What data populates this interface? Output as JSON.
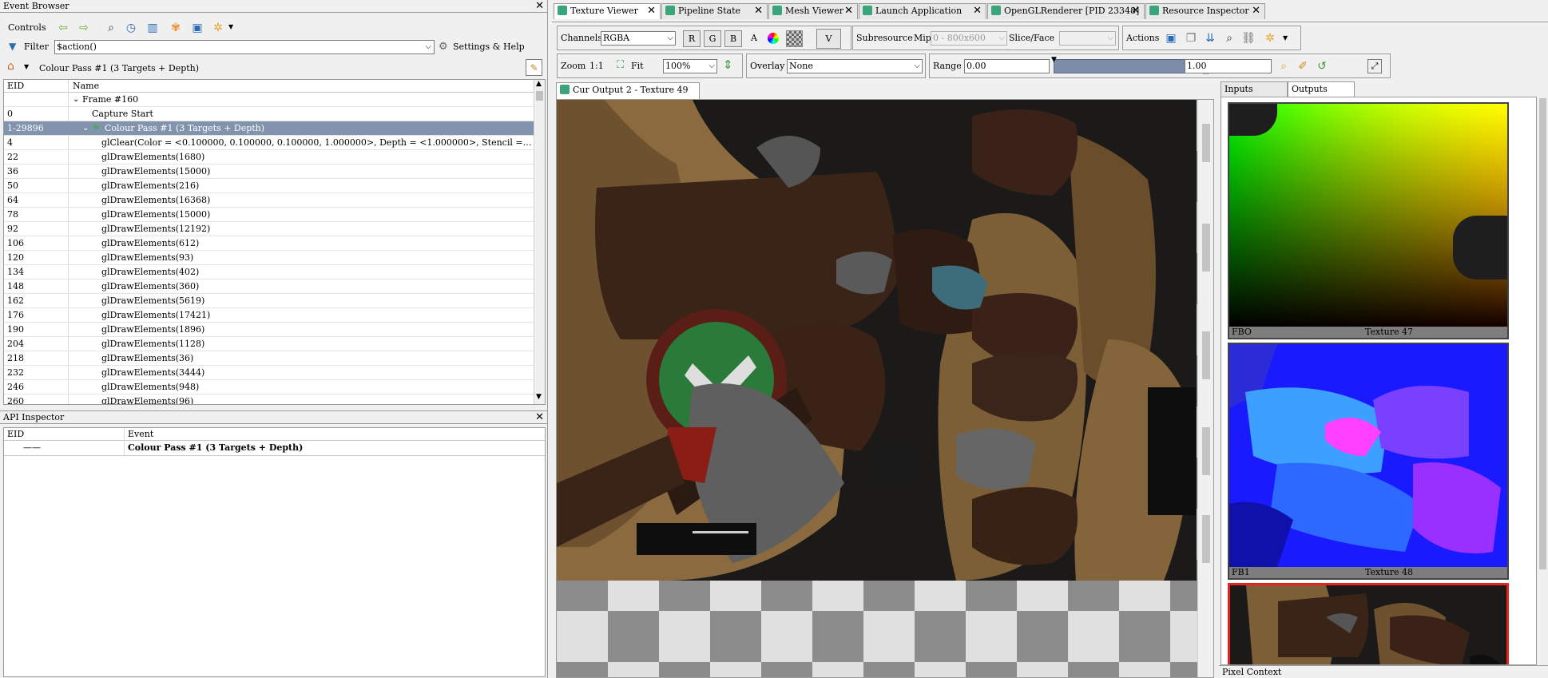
{
  "event_browser": {
    "title": "Event Browser",
    "controls_label": "Controls",
    "filter_label": "Filter",
    "filter_value": "$action()",
    "settings_label": "Settings & Help",
    "breadcrumb": "Colour Pass #1 (3 Targets + Depth)",
    "columns": [
      "EID",
      "Name"
    ],
    "rows": [
      {
        "eid": "",
        "name": "Frame #160",
        "level": 0,
        "expand": true
      },
      {
        "eid": "0",
        "name": "Capture Start",
        "level": 1
      },
      {
        "eid": "1-29896",
        "name": "Colour Pass #1 (3 Targets + Depth)",
        "level": 1,
        "expand": true,
        "flag": true,
        "selected": true
      },
      {
        "eid": "4",
        "name": "glClear(Color = <0.100000, 0.100000, 0.100000, 1.000000>, Depth = <1.000000>, Stencil =…",
        "level": 2
      },
      {
        "eid": "22",
        "name": "glDrawElements(1680)",
        "level": 2
      },
      {
        "eid": "36",
        "name": "glDrawElements(15000)",
        "level": 2
      },
      {
        "eid": "50",
        "name": "glDrawElements(216)",
        "level": 2
      },
      {
        "eid": "64",
        "name": "glDrawElements(16368)",
        "level": 2
      },
      {
        "eid": "78",
        "name": "glDrawElements(15000)",
        "level": 2
      },
      {
        "eid": "92",
        "name": "glDrawElements(12192)",
        "level": 2
      },
      {
        "eid": "106",
        "name": "glDrawElements(612)",
        "level": 2
      },
      {
        "eid": "120",
        "name": "glDrawElements(93)",
        "level": 2
      },
      {
        "eid": "134",
        "name": "glDrawElements(402)",
        "level": 2
      },
      {
        "eid": "148",
        "name": "glDrawElements(360)",
        "level": 2
      },
      {
        "eid": "162",
        "name": "glDrawElements(5619)",
        "level": 2
      },
      {
        "eid": "176",
        "name": "glDrawElements(17421)",
        "level": 2
      },
      {
        "eid": "190",
        "name": "glDrawElements(1896)",
        "level": 2
      },
      {
        "eid": "204",
        "name": "glDrawElements(1128)",
        "level": 2
      },
      {
        "eid": "218",
        "name": "glDrawElements(36)",
        "level": 2
      },
      {
        "eid": "232",
        "name": "glDrawElements(3444)",
        "level": 2
      },
      {
        "eid": "246",
        "name": "glDrawElements(948)",
        "level": 2
      },
      {
        "eid": "260",
        "name": "glDrawElements(96)",
        "level": 2
      }
    ]
  },
  "api_inspector": {
    "title": "API Inspector",
    "columns": [
      "EID",
      "Event"
    ],
    "row": {
      "eid": "——",
      "event": "Colour Pass #1 (3 Targets + Depth)"
    }
  },
  "tabs": [
    {
      "label": "Texture Viewer",
      "active": true
    },
    {
      "label": "Pipeline State"
    },
    {
      "label": "Mesh Viewer"
    },
    {
      "label": "Launch Application"
    },
    {
      "label": "OpenGLRenderer [PID 23348]"
    },
    {
      "label": "Resource Inspector"
    }
  ],
  "toolbar": {
    "channels_label": "Channels",
    "channels_value": "RGBA",
    "r": "R",
    "g": "G",
    "b": "B",
    "a": "A",
    "v": "V",
    "subresource_label": "Subresource",
    "mip_label": "Mip",
    "mip_value": "0 - 800x600",
    "slice_label": "Slice/Face",
    "actions_label": "Actions",
    "zoom_label": "Zoom",
    "zoom_1to1": "1:1",
    "fit_label": "Fit",
    "zoom_value": "100%",
    "overlay_label": "Overlay",
    "overlay_value": "None",
    "range_label": "Range",
    "range_min": "0.00",
    "range_max": "1.00"
  },
  "viewer": {
    "tab_label": "Cur Output 2 - Texture 49"
  },
  "side_panel": {
    "tab_inputs": "Inputs",
    "tab_outputs": "Outputs",
    "thumbs": [
      {
        "left": "FBO",
        "right": "Texture 47"
      },
      {
        "left": "FB1",
        "right": "Texture 48"
      }
    ],
    "pixel_context": "Pixel Context"
  },
  "colors": {
    "selection": "#8193ad",
    "tab_icon": "#3aa57a",
    "thumb_selected": "#e8231f"
  }
}
